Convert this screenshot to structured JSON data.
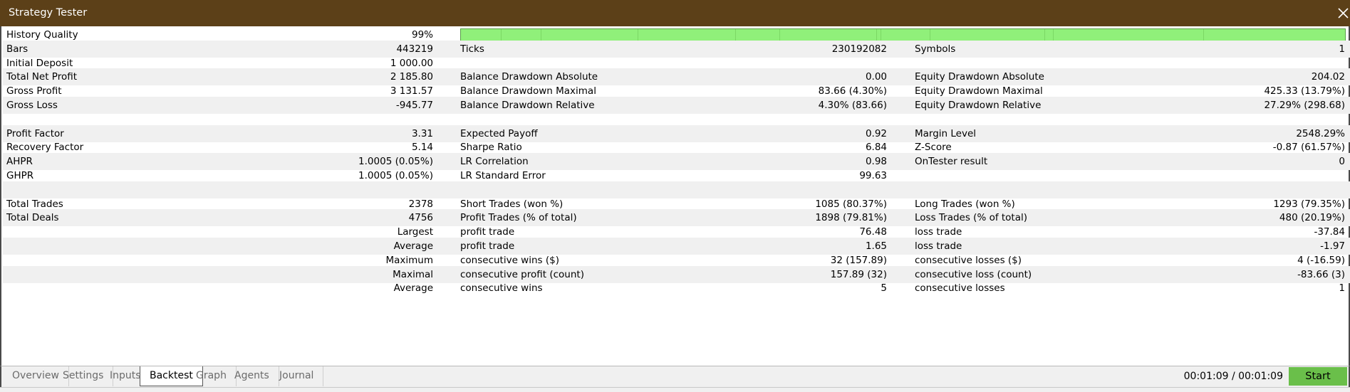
{
  "window": {
    "title": "Strategy Tester"
  },
  "history_quality": {
    "label": "History Quality",
    "value": "99%",
    "fraction": 0.99
  },
  "rows": [
    {
      "l1": "Bars",
      "v1": "443219",
      "l2": "Ticks",
      "v2": "230192082",
      "l3": "Symbols",
      "v3": "1"
    },
    {
      "l1": "Initial Deposit",
      "v1": "1 000.00",
      "l2": "",
      "v2": "",
      "l3": "",
      "v3": ""
    },
    {
      "l1": "Total Net Profit",
      "v1": "2 185.80",
      "l2": "Balance Drawdown Absolute",
      "v2": "0.00",
      "l3": "Equity Drawdown Absolute",
      "v3": "204.02"
    },
    {
      "l1": "Gross Profit",
      "v1": "3 131.57",
      "l2": "Balance Drawdown Maximal",
      "v2": "83.66 (4.30%)",
      "l3": "Equity Drawdown Maximal",
      "v3": "425.33 (13.79%)"
    },
    {
      "l1": "Gross Loss",
      "v1": "-945.77",
      "l2": "Balance Drawdown Relative",
      "v2": "4.30% (83.66)",
      "l3": "Equity Drawdown Relative",
      "v3": "27.29% (298.68)"
    },
    {
      "l1": "",
      "v1": "",
      "l2": "",
      "v2": "",
      "l3": "",
      "v3": ""
    },
    {
      "l1": "Profit Factor",
      "v1": "3.31",
      "l2": "Expected Payoff",
      "v2": "0.92",
      "l3": "Margin Level",
      "v3": "2548.29%"
    },
    {
      "l1": "Recovery Factor",
      "v1": "5.14",
      "l2": "Sharpe Ratio",
      "v2": "6.84",
      "l3": "Z-Score",
      "v3": "-0.87 (61.57%)"
    },
    {
      "l1": "AHPR",
      "v1": "1.0005 (0.05%)",
      "l2": "LR Correlation",
      "v2": "0.98",
      "l3": "OnTester result",
      "v3": "0"
    },
    {
      "l1": "GHPR",
      "v1": "1.0005 (0.05%)",
      "l2": "LR Standard Error",
      "v2": "99.63",
      "l3": "",
      "v3": ""
    },
    {
      "l1": "",
      "v1": "",
      "l2": "",
      "v2": "",
      "l3": "",
      "v3": ""
    },
    {
      "l1": "Total Trades",
      "v1": "2378",
      "l2": "Short Trades (won %)",
      "v2": "1085 (80.37%)",
      "l3": "Long Trades (won %)",
      "v3": "1293 (79.35%)"
    },
    {
      "l1": "Total Deals",
      "v1": "4756",
      "l2": "Profit Trades (% of total)",
      "v2": "1898 (79.81%)",
      "l3": "Loss Trades (% of total)",
      "v3": "480 (20.19%)"
    },
    {
      "l1": "",
      "v1": "Largest",
      "l2": "profit trade",
      "v2": "76.48",
      "l3": "loss trade",
      "v3": "-37.84"
    },
    {
      "l1": "",
      "v1": "Average",
      "l2": "profit trade",
      "v2": "1.65",
      "l3": "loss trade",
      "v3": "-1.97"
    },
    {
      "l1": "",
      "v1": "Maximum",
      "l2": "consecutive wins ($)",
      "v2": "32 (157.89)",
      "l3": "consecutive losses ($)",
      "v3": "4 (-16.59)"
    },
    {
      "l1": "",
      "v1": "Maximal",
      "l2": "consecutive profit (count)",
      "v2": "157.89 (32)",
      "l3": "consecutive loss (count)",
      "v3": "-83.66 (3)"
    },
    {
      "l1": "",
      "v1": "Average",
      "l2": "consecutive wins",
      "v2": "5",
      "l3": "consecutive losses",
      "v3": "1"
    }
  ],
  "tabs": [
    {
      "label": "Overview",
      "active": false
    },
    {
      "label": "Settings",
      "active": false
    },
    {
      "label": "Inputs",
      "active": false
    },
    {
      "label": "Backtest",
      "active": true
    },
    {
      "label": "Graph",
      "active": false
    },
    {
      "label": "Agents",
      "active": false
    },
    {
      "label": "Journal",
      "active": false
    }
  ],
  "timer": "00:01:09 / 00:01:09",
  "start_button": "Start",
  "colors": {
    "titlebar": "#5c4018",
    "quality_bar": "#90f07a",
    "start_button": "#6abf4a"
  }
}
